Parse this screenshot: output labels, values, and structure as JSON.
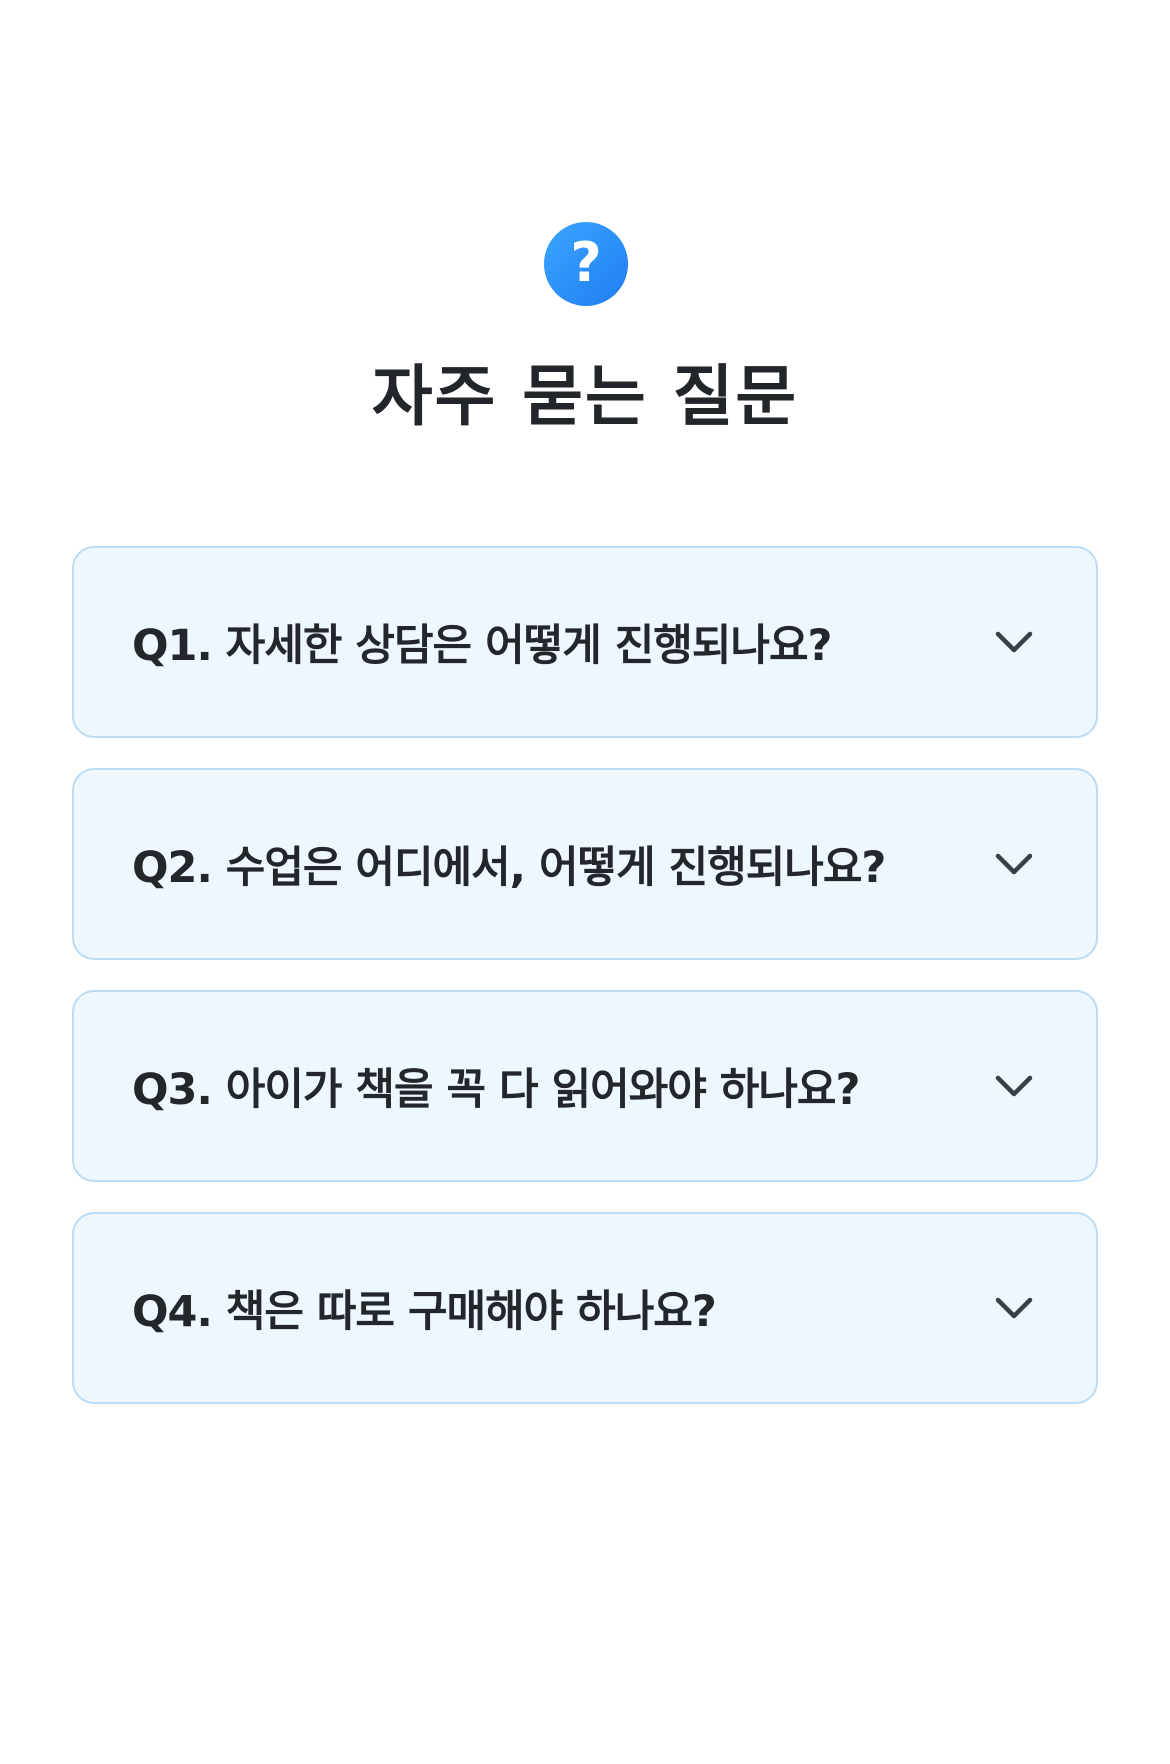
{
  "header": {
    "icon": "question-circle-icon",
    "icon_glyph": "?",
    "title": "자주 묻는 질문",
    "accent_color": "#1f7df2"
  },
  "faq": {
    "items": [
      {
        "question": "Q1. 자세한 상담은 어떻게 진행되나요?",
        "icon": "chevron-down-icon"
      },
      {
        "question": "Q2. 수업은 어디에서, 어떻게 진행되나요?",
        "icon": "chevron-down-icon"
      },
      {
        "question": "Q3. 아이가 책을 꼭 다 읽어와야 하나요?",
        "icon": "chevron-down-icon"
      },
      {
        "question": "Q4. 책은 따로 구매해야 하나요?",
        "icon": "chevron-down-icon"
      }
    ],
    "item_background": "#eef6fe",
    "item_border": "#bcdcf4"
  }
}
